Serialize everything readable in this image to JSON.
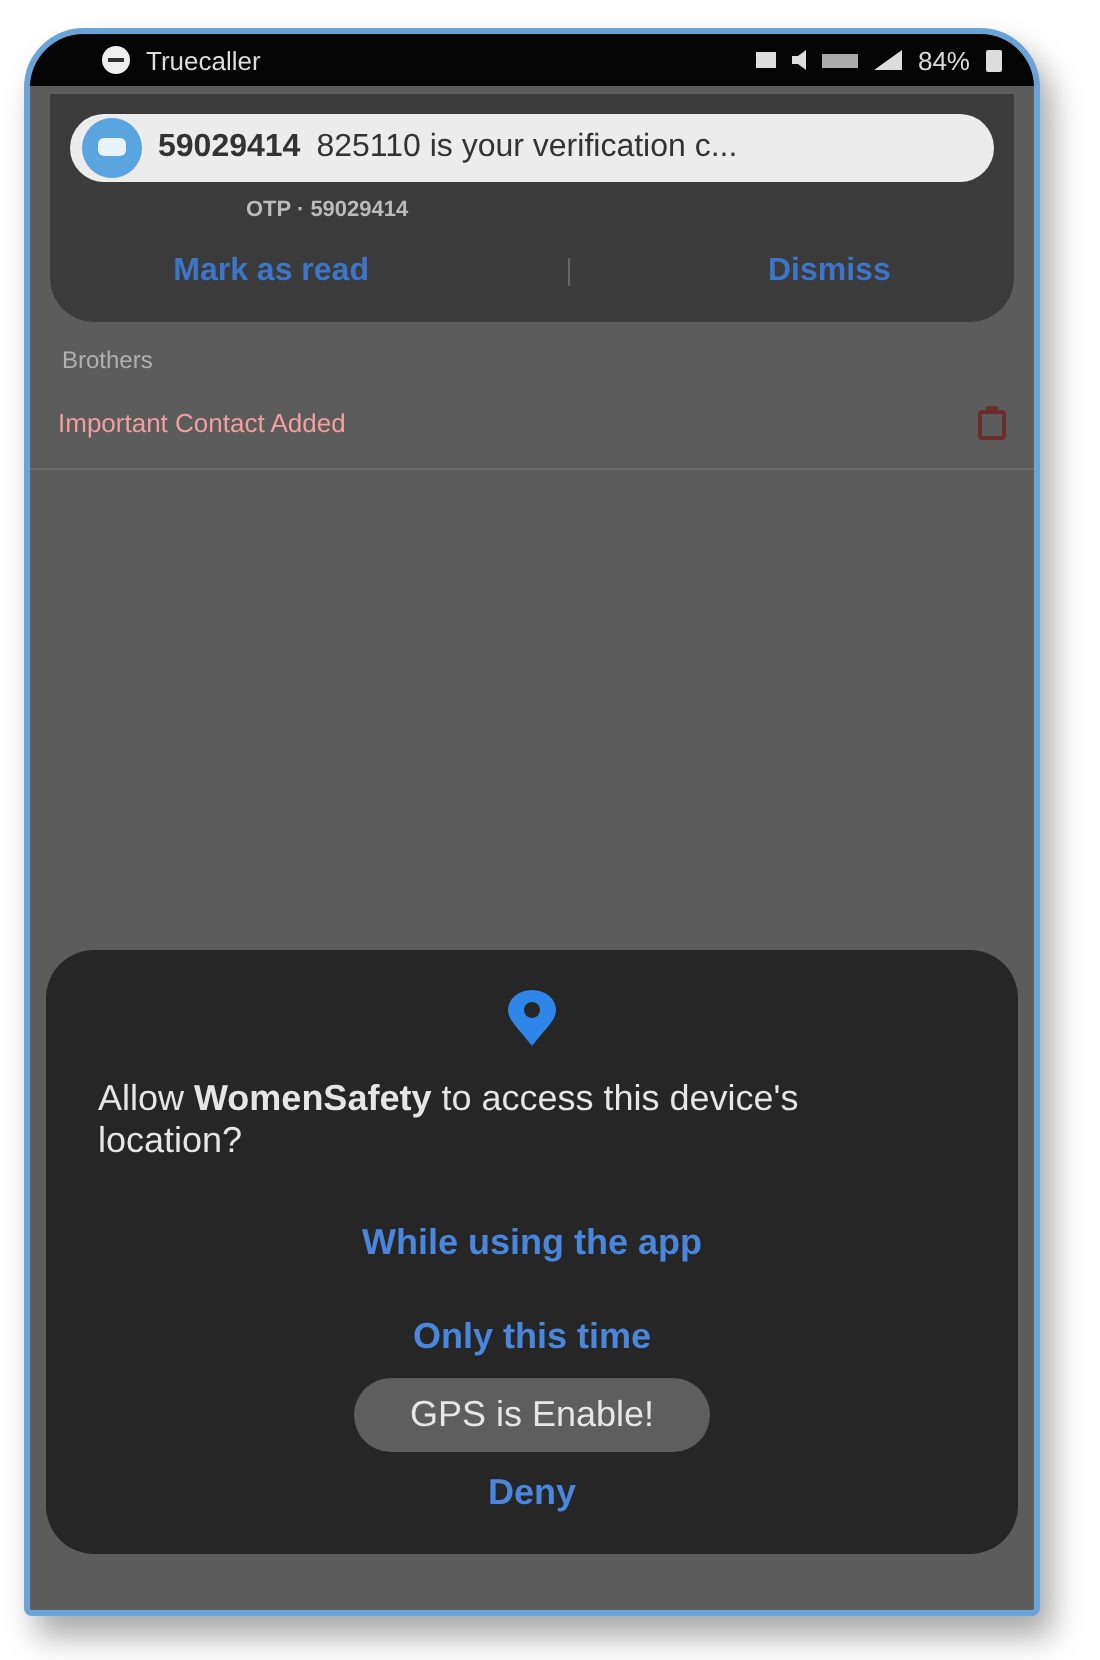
{
  "status_bar": {
    "app": "Truecaller",
    "battery": "84%"
  },
  "heads_up": {
    "sender": "59029414",
    "message": "825110 is your verification c..."
  },
  "notification": {
    "subtitle": "OTP · 59029414",
    "actions": [
      "Mark as read",
      "Dismiss"
    ]
  },
  "list": {
    "section": "Brothers",
    "items": [
      {
        "title": "Important Contact Added"
      }
    ]
  },
  "dialog": {
    "message": "Allow **WomenSafety** to access this device's location?",
    "options": [
      "While using the app",
      "Only this time",
      "Deny"
    ]
  },
  "toast": "GPS is Enable!"
}
